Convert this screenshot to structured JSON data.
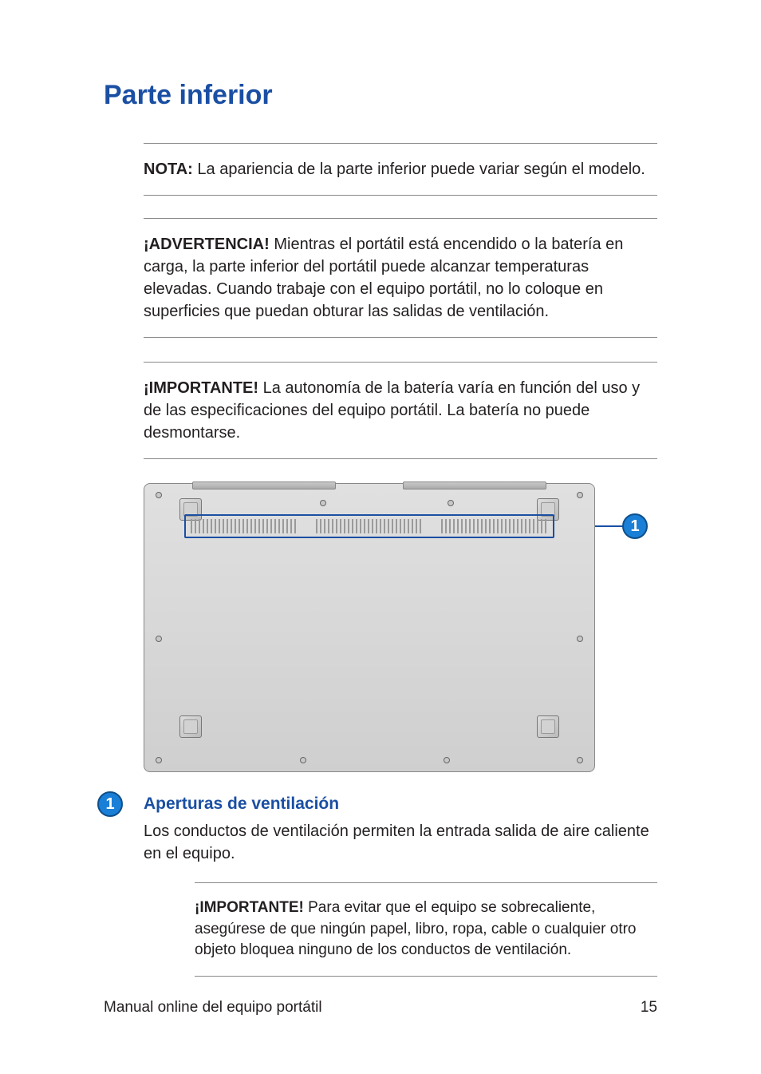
{
  "heading": "Parte inferior",
  "notes": {
    "nota": {
      "label": "NOTA:",
      "text": " La apariencia de la parte inferior puede variar según el modelo."
    },
    "advertencia": {
      "label": "¡ADVERTENCIA!",
      "text": " Mientras el portátil está encendido o la batería en carga, la parte inferior del portátil puede alcanzar temperaturas elevadas. Cuando trabaje con el equipo portátil, no lo coloque en superficies que puedan obturar las salidas de ventilación."
    },
    "importante1": {
      "label": "¡IMPORTANTE!",
      "text": " La autonomía de la batería varía en función del uso y de las especificaciones del equipo portátil. La batería no puede desmontarse."
    },
    "importante2": {
      "label": "¡IMPORTANTE!",
      "text": " Para evitar que el equipo se sobrecaliente, asegúrese de que ningún papel, libro, ropa, cable o cualquier otro objeto bloquea ninguno de los conductos de ventilación."
    }
  },
  "callouts": {
    "c1": {
      "num": "1",
      "title": "Aperturas de ventilación",
      "text": "Los conductos de ventilación permiten la entrada salida de aire caliente en el equipo."
    }
  },
  "footer": {
    "left": "Manual online del equipo portátil",
    "right": "15"
  }
}
